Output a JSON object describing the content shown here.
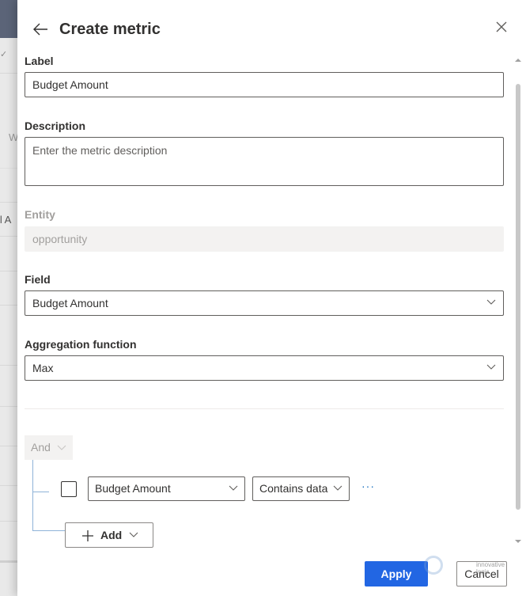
{
  "backdrop": {
    "fragments": [
      "W",
      "il A"
    ]
  },
  "panel": {
    "title": "Create metric",
    "back_icon": "arrow-left-icon",
    "close_icon": "close-icon"
  },
  "form": {
    "label": {
      "label": "Label",
      "value": "Budget Amount"
    },
    "description": {
      "label": "Description",
      "placeholder": "Enter the metric description",
      "value": ""
    },
    "entity": {
      "label": "Entity",
      "value": "opportunity",
      "disabled": true
    },
    "field": {
      "label": "Field",
      "value": "Budget Amount"
    },
    "aggregation": {
      "label": "Aggregation function",
      "value": "Max"
    }
  },
  "filter": {
    "group_operator": "And",
    "conditions": [
      {
        "checked": false,
        "field": "Budget Amount",
        "operator": "Contains data",
        "more_icon": "more-horizontal-icon"
      }
    ],
    "add_label": "Add"
  },
  "footer": {
    "apply_label": "Apply",
    "cancel_label": "Cancel",
    "watermark_text": "innovative logic"
  },
  "colors": {
    "primary": "#2266e3",
    "tree_line": "#8fb3d8",
    "link": "#0f6cbd"
  }
}
